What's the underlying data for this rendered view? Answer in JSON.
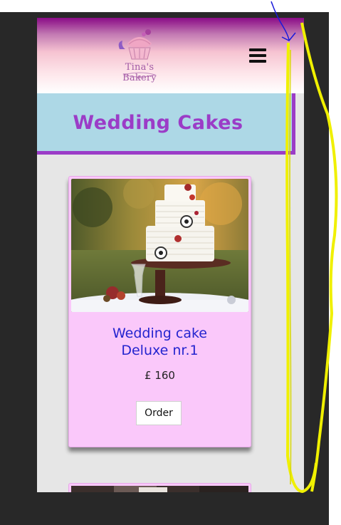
{
  "header": {
    "logo_text": "Tina's Bakery",
    "menu_icon": "hamburger-menu-icon"
  },
  "page": {
    "title": "Wedding Cakes"
  },
  "products": [
    {
      "name_line1": "Wedding cake",
      "name_line2": "Deluxe nr.1",
      "price": "£ 160",
      "order_label": "Order"
    }
  ],
  "colors": {
    "header_top": "#8a0a86",
    "title_band": "#add8e6",
    "title_text": "#9b3cc7",
    "card_bg": "#fac8fa",
    "product_name": "#2424cf",
    "annotation_yellow": "#f0f000",
    "annotation_blue": "#1a1adb"
  }
}
